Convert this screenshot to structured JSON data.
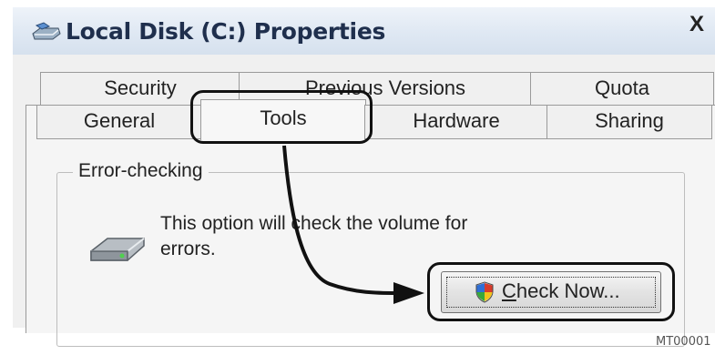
{
  "window": {
    "title": "Local Disk (C:) Properties",
    "close_glyph": "X"
  },
  "tabs": {
    "row1": [
      {
        "label": "Security"
      },
      {
        "label": "Previous Versions"
      },
      {
        "label": "Quota"
      }
    ],
    "row2": [
      {
        "label": "General"
      },
      {
        "label": "Tools",
        "active": true
      },
      {
        "label": "Hardware"
      },
      {
        "label": "Sharing"
      }
    ]
  },
  "error_checking": {
    "group_label": "Error-checking",
    "description_line1": "This option will check the volume for",
    "description_line2": "errors.",
    "button": {
      "mnemonic": "C",
      "rest": "heck Now..."
    }
  },
  "icons": {
    "app": "disk-properties-icon",
    "drive": "hard-drive-icon",
    "shield": "uac-shield-icon"
  },
  "colors": {
    "title_text": "#1f2f4d",
    "titlebar_bg": "#dfe8f3",
    "dialog_bg": "#f0f0f0",
    "callout": "#111111"
  },
  "footer": {
    "code": "MT00001"
  }
}
